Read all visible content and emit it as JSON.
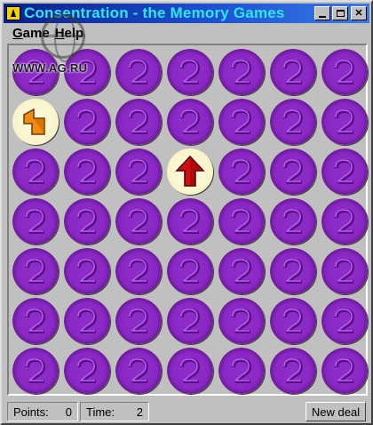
{
  "window": {
    "title": "Consentration - the Memory Games",
    "controls": {
      "minimize": "_",
      "maximize": "□",
      "close": "✕"
    }
  },
  "menu": {
    "items": [
      {
        "label": "Game",
        "accel": "G"
      },
      {
        "label": "Help",
        "accel": "H"
      }
    ]
  },
  "watermark": "WWW.AG.RU",
  "board": {
    "rows": 7,
    "cols": 7,
    "revealed": [
      {
        "row": 1,
        "col": 0,
        "picture": "orange-square-arrow-icon"
      },
      {
        "row": 2,
        "col": 3,
        "picture": "red-up-arrow-icon"
      }
    ],
    "back_icon": "purple-coin-back-icon"
  },
  "status": {
    "points_label": "Points:",
    "points_value": "0",
    "time_label": "Time:",
    "time_value": "2",
    "new_deal_label": "New deal"
  },
  "colors": {
    "title_bar": "#1a4fd0",
    "title_text": "#2ee8f0",
    "card_back": "#8a28c4",
    "card_rim": "#f0c020",
    "window_face": "#c0c0c0"
  }
}
